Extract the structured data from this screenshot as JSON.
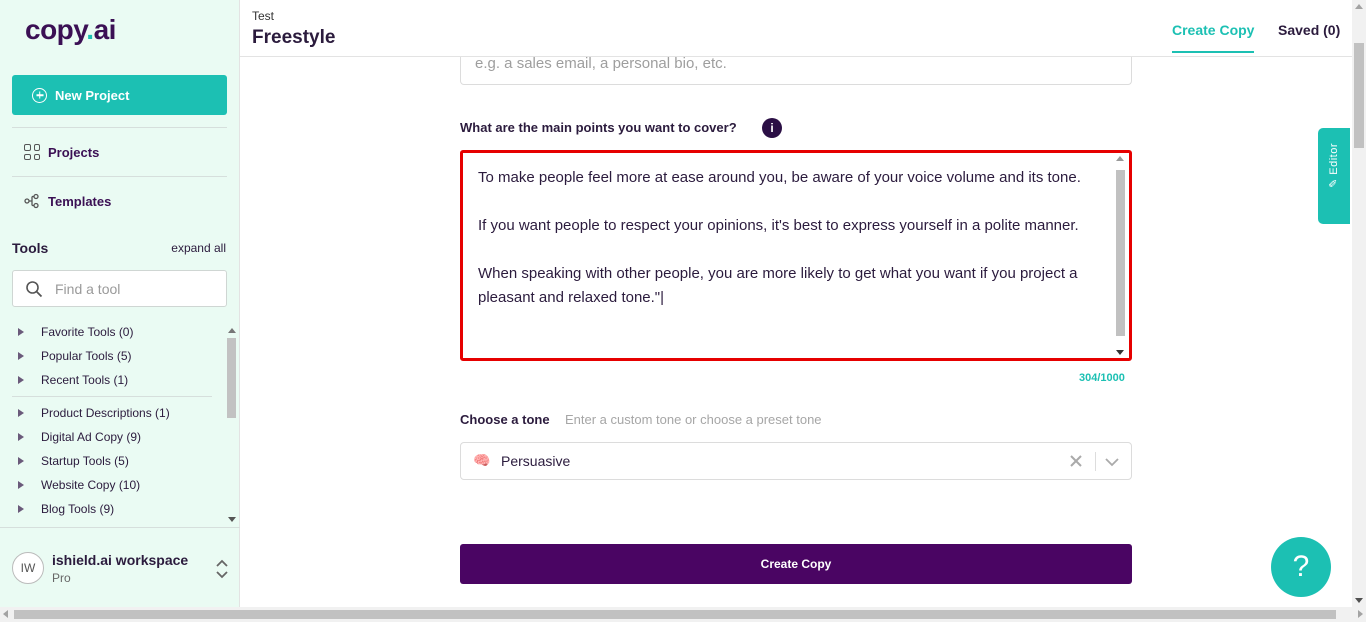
{
  "brand": {
    "logo_main": "copy",
    "logo_dot": ".",
    "logo_tail": "ai",
    "accent": "#1cc0b3",
    "primary": "#4a0563"
  },
  "sidebar": {
    "new_project_label": "New Project",
    "nav": [
      {
        "label": "Projects",
        "icon": "grid-icon"
      },
      {
        "label": "Templates",
        "icon": "share-nodes-icon"
      }
    ],
    "tools_label": "Tools",
    "expand_all_label": "expand all",
    "search_placeholder": "Find a tool",
    "tool_groups": [
      "Favorite Tools (0)",
      "Popular Tools (5)",
      "Recent Tools (1)",
      "Product Descriptions (1)",
      "Digital Ad Copy (9)",
      "Startup Tools (5)",
      "Website Copy (10)",
      "Blog Tools (9)"
    ],
    "workspace": {
      "initials": "IW",
      "name": "ishield.ai workspace",
      "plan": "Pro"
    }
  },
  "header": {
    "breadcrumb": "Test",
    "title": "Freestyle",
    "tabs": {
      "create": "Create Copy",
      "saved": "Saved (0)"
    }
  },
  "form": {
    "top_placeholder": "e.g. a sales email, a personal bio, etc.",
    "points_label": "What are the main points you want to cover?",
    "info_glyph": "i",
    "points_paragraphs": [
      "To make people feel more at ease around you, be aware of your voice volume and its tone.",
      "",
      "If you want people to respect your opinions, it's best to express yourself in a polite manner.",
      "",
      "When speaking with other people, you are more likely to get what you want if you project a pleasant and relaxed tone.\"|"
    ],
    "char_count": "304/1000",
    "tone_label": "Choose a tone",
    "tone_hint": "Enter a custom tone or choose a preset tone",
    "tone_emoji": "🧠",
    "tone_value": "Persuasive",
    "create_button": "Create Copy"
  },
  "editor_tab_label": "Editor",
  "help_glyph": "?"
}
